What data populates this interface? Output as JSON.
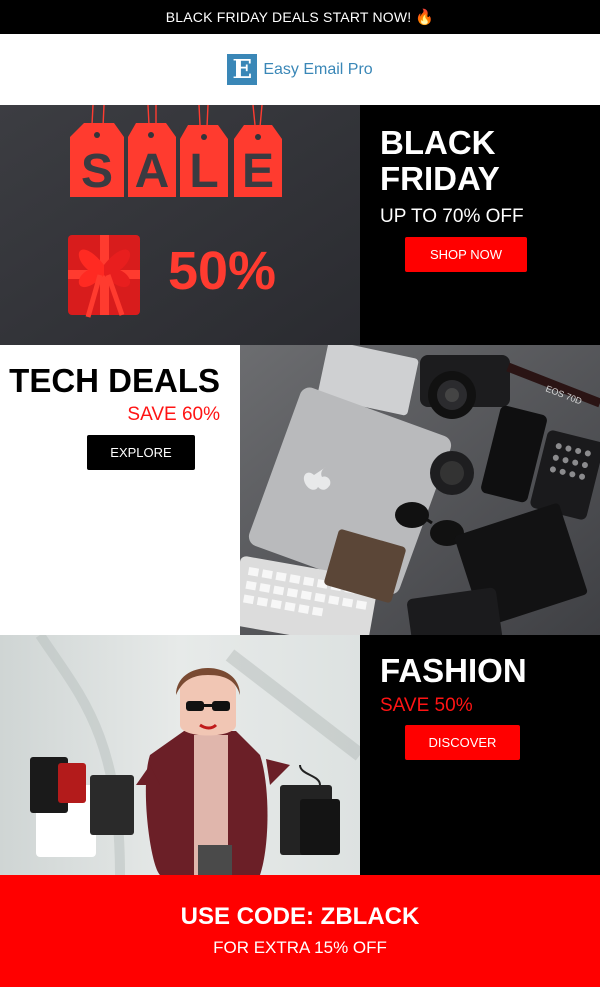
{
  "top_bar": {
    "text": "BLACK FRIDAY DEALS START NOW!",
    "emoji": "🔥"
  },
  "logo": {
    "mark": "E",
    "name": "Easy Email Pro",
    "color": "#3a87b7"
  },
  "hero": {
    "sale_letters": [
      "S",
      "A",
      "L",
      "E"
    ],
    "image_percent": "50%",
    "title_line1": "BLACK",
    "title_line2": "FRIDAY",
    "subtitle": "UP TO 70% OFF",
    "button": "SHOP NOW"
  },
  "tech": {
    "title": "TECH DEALS",
    "subtitle": "SAVE 60%",
    "button": "EXPLORE",
    "camera_label": "EOS 70D"
  },
  "fashion": {
    "title": "FASHION",
    "subtitle": "SAVE 50%",
    "button": "DISCOVER"
  },
  "footer": {
    "code_line": "USE CODE: ZBLACK",
    "extra_line": "FOR EXTRA 15% OFF"
  },
  "colors": {
    "accent_red": "#ff0000",
    "black": "#000000",
    "brand_blue": "#3a87b7"
  }
}
